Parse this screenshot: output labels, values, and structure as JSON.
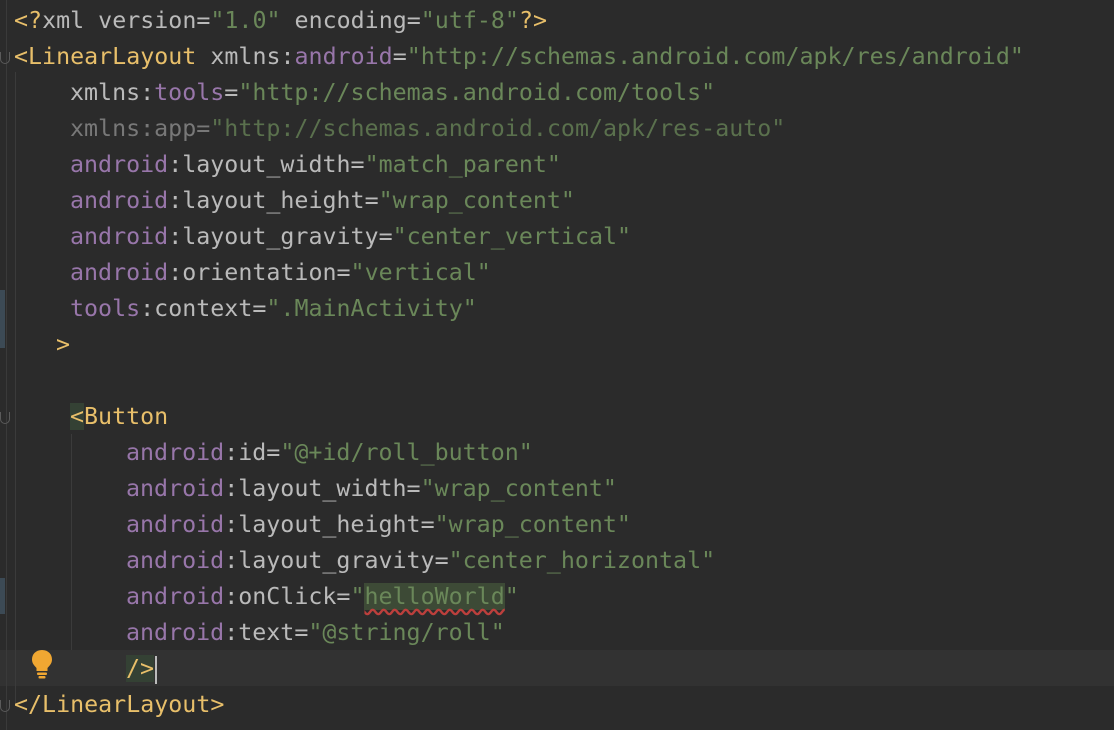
{
  "lines": [
    {
      "decl_open": "<?",
      "decl_name": "xml",
      "decl_a1": " version=",
      "decl_v1": "\"1.0\"",
      "decl_a2": " encoding=",
      "decl_v2": "\"utf-8\"",
      "decl_close": "?>"
    },
    {
      "tag_open": "<LinearLayout",
      "attr_xmlns": " xmlns:",
      "ns": "android",
      "eq": "=",
      "value": "\"http://schemas.android.com/apk/res/android\""
    },
    {
      "attr_xmlns": "xmlns:",
      "ns": "tools",
      "eq": "=",
      "value": "\"http://schemas.android.com/tools\""
    },
    {
      "text": "xmlns:app=",
      "value": "\"http://schemas.android.com/apk/res-auto\""
    },
    {
      "ns": "android",
      "colon": ":",
      "attr": "layout_width",
      "eq": "=",
      "value": "\"match_parent\""
    },
    {
      "ns": "android",
      "colon": ":",
      "attr": "layout_height",
      "eq": "=",
      "value": "\"wrap_content\""
    },
    {
      "ns": "android",
      "colon": ":",
      "attr": "layout_gravity",
      "eq": "=",
      "value": "\"center_vertical\""
    },
    {
      "ns": "android",
      "colon": ":",
      "attr": "orientation",
      "eq": "=",
      "value": "\"vertical\""
    },
    {
      "ns": "tools",
      "colon": ":",
      "attr": "context",
      "eq": "=",
      "value": "\".MainActivity\""
    },
    {
      "tag": ">"
    },
    {
      "tag_lt": "<",
      "tag_name": "Button"
    },
    {
      "ns": "android",
      "colon": ":",
      "attr": "id",
      "eq": "=",
      "value": "\"@+id/roll_button\""
    },
    {
      "ns": "android",
      "colon": ":",
      "attr": "layout_width",
      "eq": "=",
      "value": "\"wrap_content\""
    },
    {
      "ns": "android",
      "colon": ":",
      "attr": "layout_height",
      "eq": "=",
      "value": "\"wrap_content\""
    },
    {
      "ns": "android",
      "colon": ":",
      "attr": "layout_gravity",
      "eq": "=",
      "value": "\"center_horizontal\""
    },
    {
      "ns": "android",
      "colon": ":",
      "attr": "onClick",
      "eq": "=",
      "q1": "\"",
      "word": "helloWorld",
      "q2": "\""
    },
    {
      "ns": "android",
      "colon": ":",
      "attr": "text",
      "eq": "=",
      "value": "\"@string/roll\""
    },
    {
      "tag": "/>"
    },
    {
      "tag": "</LinearLayout>"
    }
  ],
  "icons": {
    "intention_bulb": "lightbulb-icon"
  },
  "colors": {
    "background": "#2b2b2b",
    "tag": "#e8bf6a",
    "namespace": "#9876aa",
    "value": "#6a8759",
    "attribute": "#bababa",
    "bulb": "#f0a732"
  }
}
